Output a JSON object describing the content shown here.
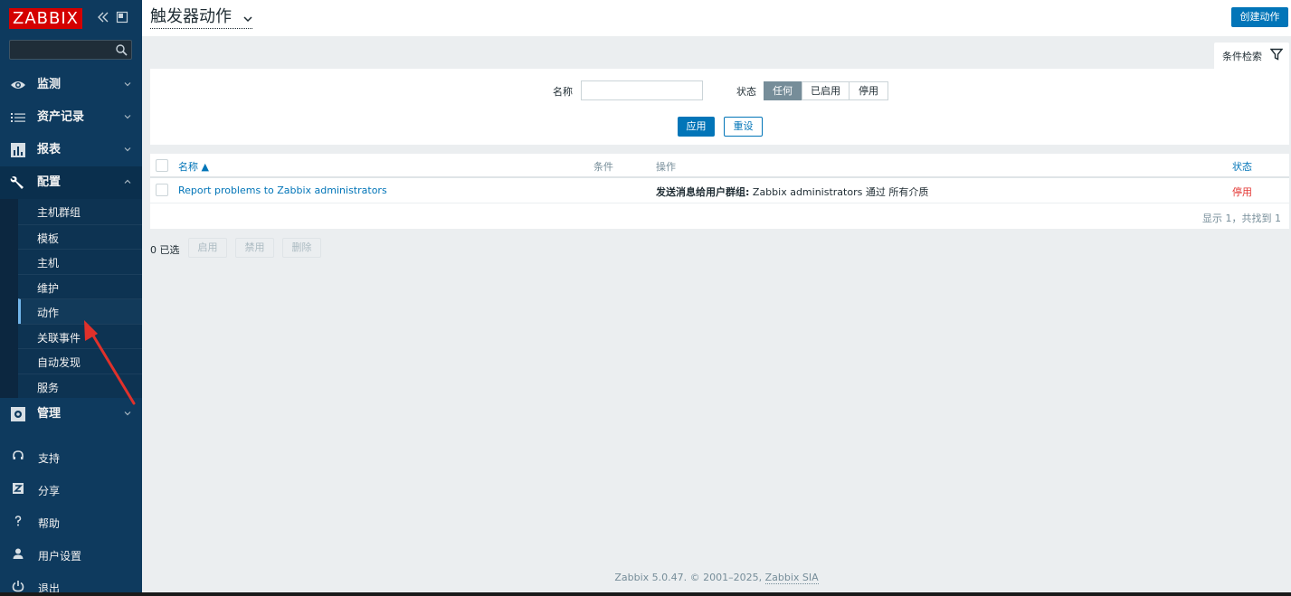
{
  "sidebar": {
    "logo": "ZABBIX",
    "search": {
      "value": "",
      "placeholder": ""
    },
    "menu": [
      {
        "label": "监测",
        "icon": "eye-icon"
      },
      {
        "label": "资产记录",
        "icon": "list-icon"
      },
      {
        "label": "报表",
        "icon": "bar-chart-icon"
      },
      {
        "label": "配置",
        "icon": "wrench-icon"
      }
    ],
    "config_submenu": [
      "主机群组",
      "模板",
      "主机",
      "维护",
      "动作",
      "关联事件",
      "自动发现",
      "服务"
    ],
    "active_submenu": "动作",
    "admin": {
      "label": "管理",
      "icon": "gear-icon"
    },
    "bottom": [
      {
        "label": "支持",
        "icon": "headset-icon"
      },
      {
        "label": "分享",
        "icon": "share-icon"
      },
      {
        "label": "帮助",
        "icon": "help-icon"
      },
      {
        "label": "用户设置",
        "icon": "user-icon"
      },
      {
        "label": "退出",
        "icon": "power-icon"
      }
    ]
  },
  "header": {
    "title": "触发器动作",
    "create_button": "创建动作"
  },
  "filter": {
    "tab_label": "条件检索",
    "name_label": "名称",
    "name_value": "",
    "status_label": "状态",
    "status_options": [
      "任何",
      "已启用",
      "停用"
    ],
    "status_selected": "任何",
    "apply": "应用",
    "reset": "重设"
  },
  "table": {
    "columns": {
      "name": "名称 ▲",
      "conditions": "条件",
      "operations": "操作",
      "status": "状态"
    },
    "rows": [
      {
        "name": "Report problems to Zabbix administrators",
        "conditions": "",
        "operation_bold": "发送消息给用户群组:",
        "operation_rest": " Zabbix administrators 通过 所有介质",
        "status": "停用"
      }
    ],
    "paging": "显示 1，共找到 1"
  },
  "actions_bar": {
    "selected": "0 已选",
    "enable": "启用",
    "disable": "禁用",
    "delete": "删除"
  },
  "footer": {
    "text": "Zabbix 5.0.47. © 2001–2025, ",
    "company": "Zabbix SIA"
  },
  "colors": {
    "sidebar_bg": "#0e3a5e",
    "accent": "#0275b8",
    "logo_red": "#d40000",
    "status_disabled": "#e33734",
    "annotation_arrow": "#e0312b"
  }
}
